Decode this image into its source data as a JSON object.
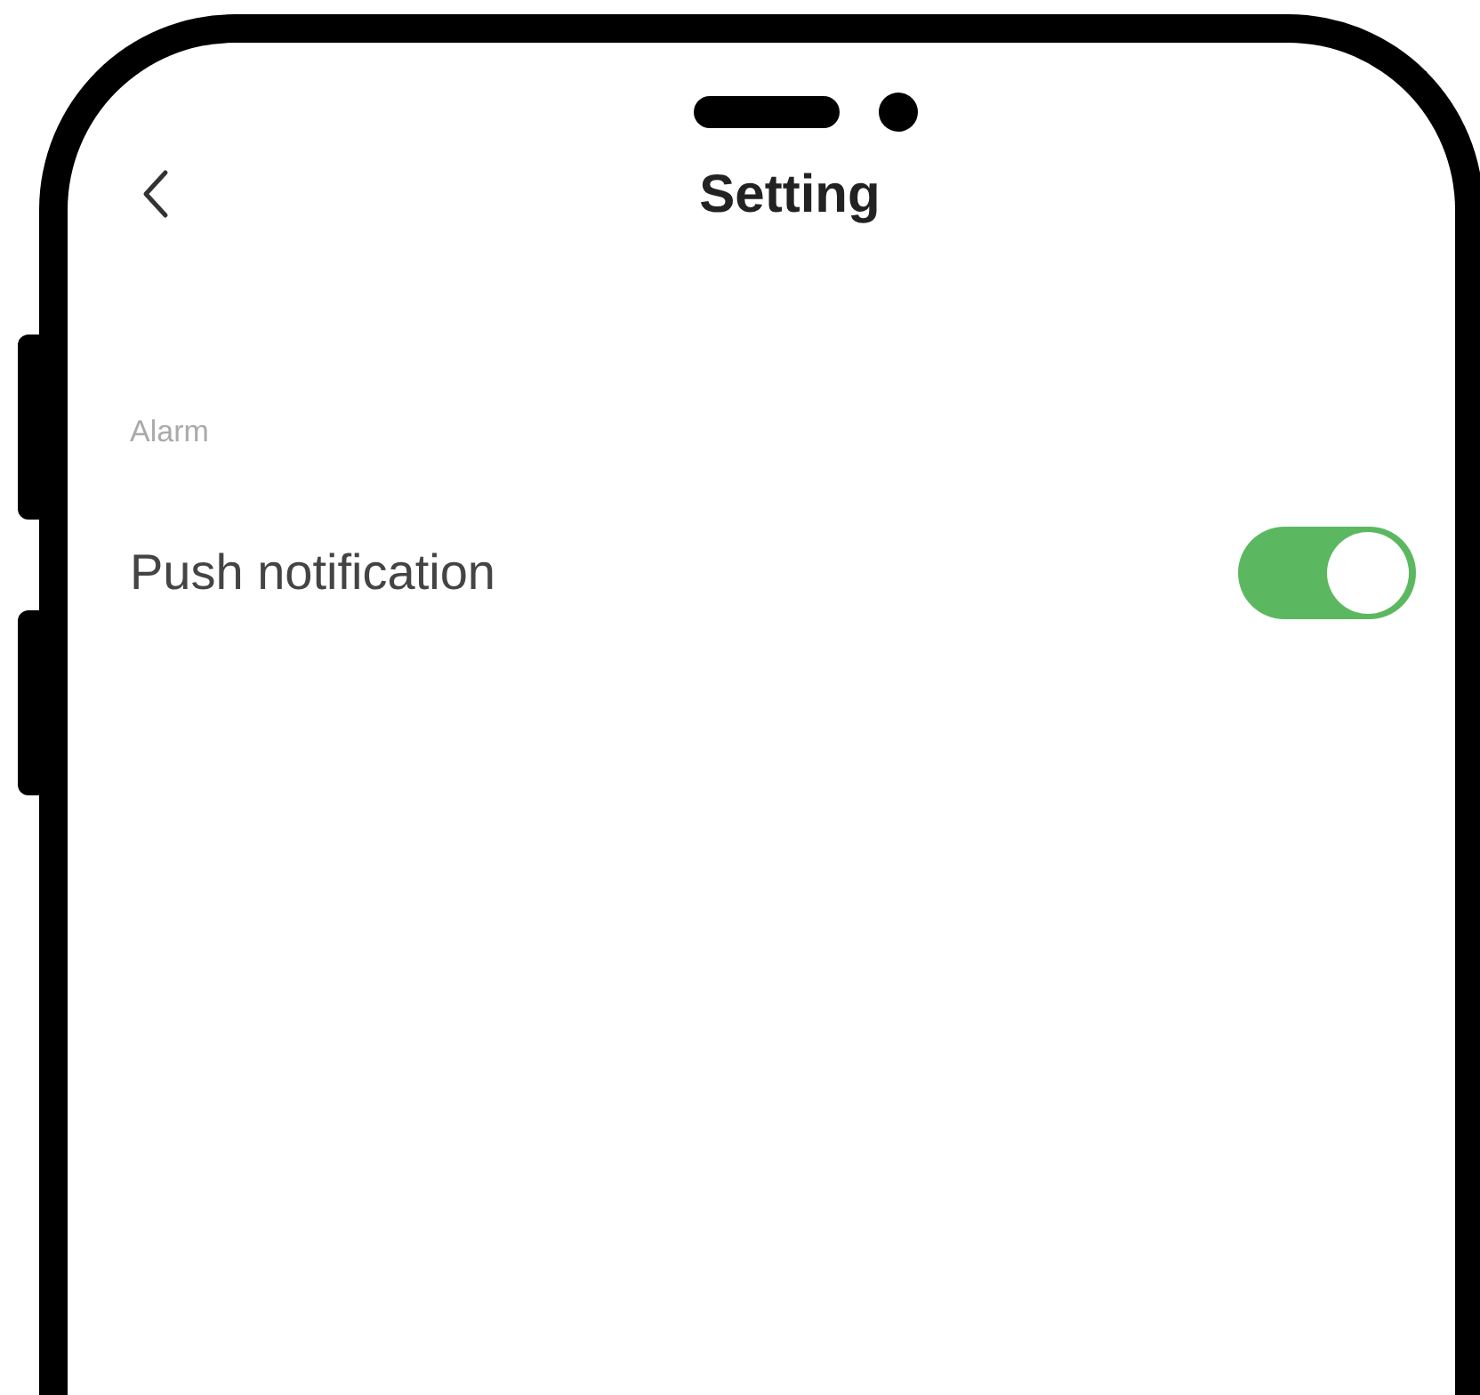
{
  "header": {
    "title": "Setting"
  },
  "sections": [
    {
      "title": "Alarm",
      "items": [
        {
          "label": "Push notification",
          "kind": "toggle",
          "on": true
        }
      ]
    }
  ]
}
